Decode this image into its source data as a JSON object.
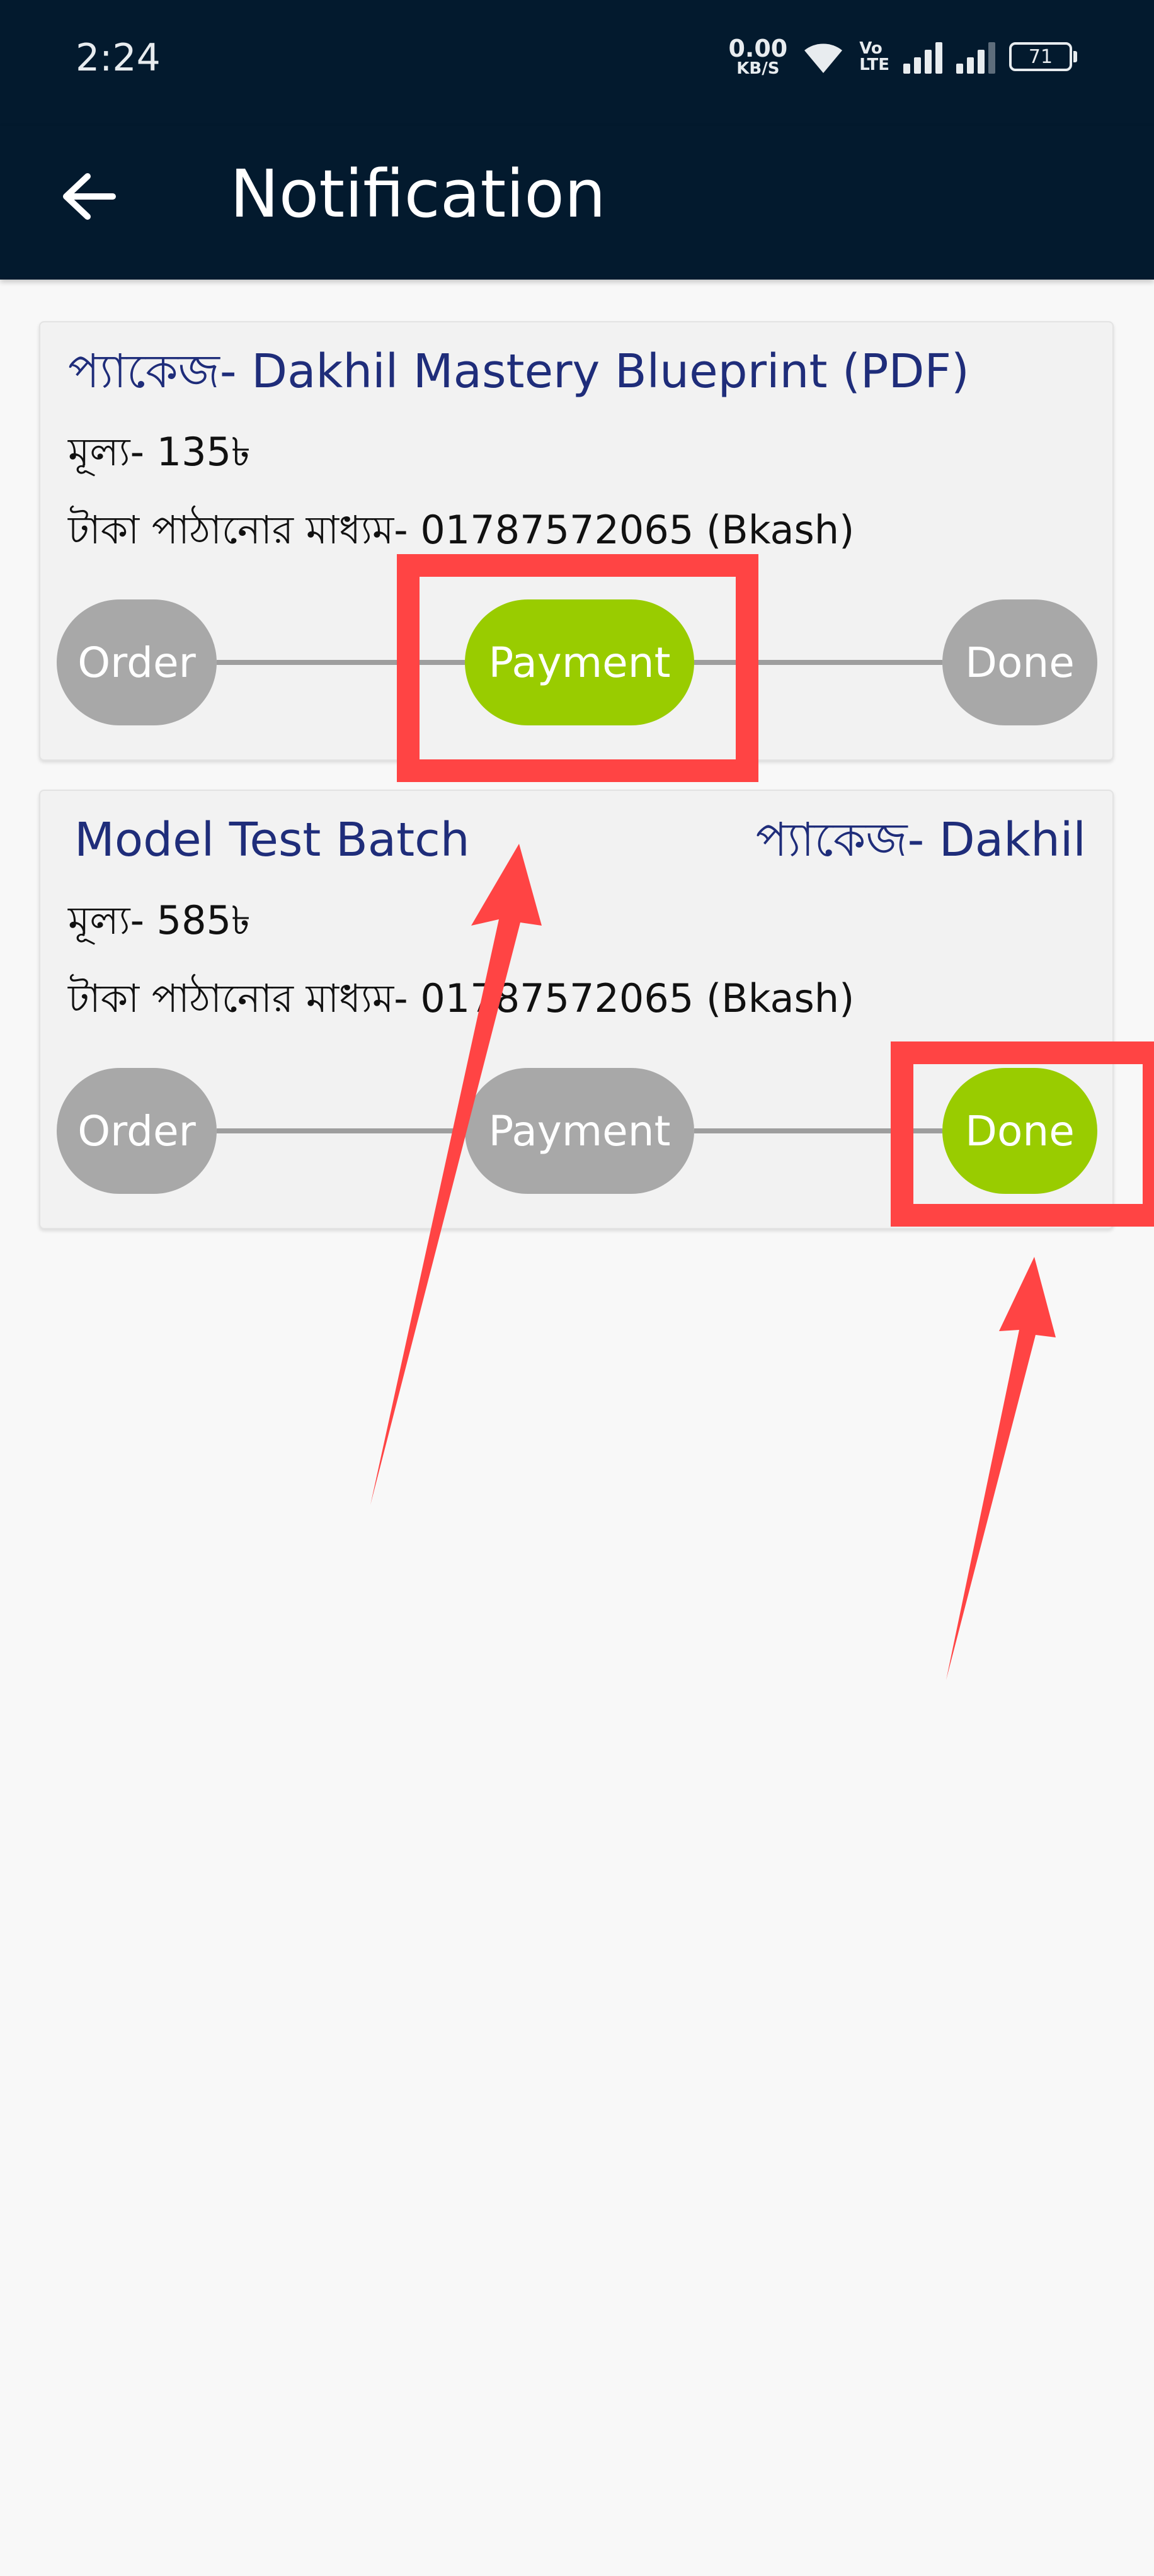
{
  "status_bar": {
    "time": "2:24",
    "net_speed_value": "0.00",
    "net_speed_unit": "KB/S",
    "volte_top": "Vo",
    "volte_bottom": "LTE",
    "battery": "71",
    "icons": [
      "wifi-icon",
      "volte-icon",
      "signal-icon",
      "signal-icon",
      "battery-icon"
    ]
  },
  "header": {
    "title": "Notification",
    "back_icon": "arrow-left-icon"
  },
  "notifications": [
    {
      "title": "প্যাকেজ- Dakhil Mastery Blueprint (PDF)",
      "price": "মূল্য- 135৳",
      "payment_method": "টাকা পাঠানোর মাধ্যম- 01787572065 (Bkash)",
      "steps": [
        "Order",
        "Payment",
        "Done"
      ],
      "active_step": "Payment"
    },
    {
      "title": "Model Test Batch",
      "package": "প্যাকেজ- Dakhil",
      "price": "মূল্য- 585৳",
      "payment_method": "টাকা পাঠানোর মাধ্যম- 01787572065 (Bkash)",
      "steps": [
        "Order",
        "Payment",
        "Done"
      ],
      "active_step": "Done"
    }
  ],
  "colors": {
    "app_bar": "#031a2e",
    "active_step": "#99cc00",
    "inactive_step": "#a8a8a8",
    "title_text": "#1f2d7a",
    "annotation": "#ff4444"
  }
}
